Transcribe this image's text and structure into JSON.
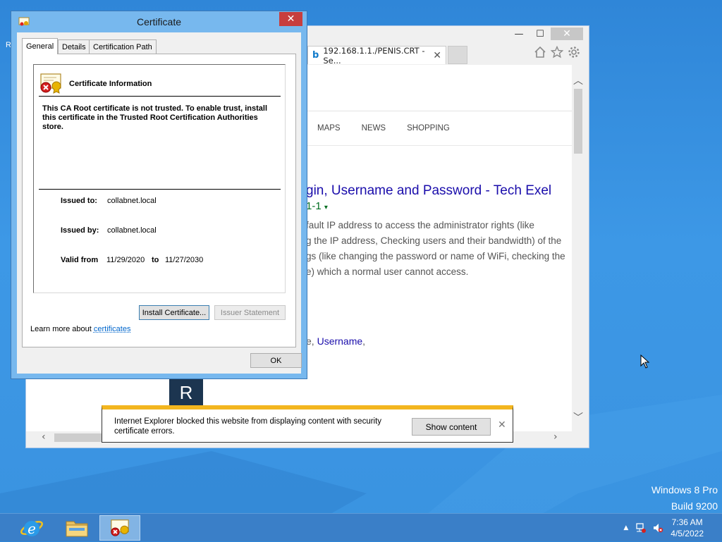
{
  "ie": {
    "tab_title": "192.168.1.1./PENIS.CRT - Se...",
    "tab_close": "✕",
    "caption": {
      "minimize": "—",
      "maximize": "☐",
      "close": "✕"
    },
    "nav": [
      "MAPS",
      "NEWS",
      "SHOPPING"
    ],
    "result_title": "gin, Username and Password - Tech Exel",
    "result_url": "1-1",
    "result_lines": [
      "fault IP address to access the administrator rights (like",
      "g the IP address, Checking users and their bandwidth) of the",
      "gs (like changing the password or name of WiFi, checking the",
      "e) which a normal user cannot access."
    ],
    "result_link2_prefix": "e, ",
    "result_link2": "Username",
    "result_link2_suffix": ","
  },
  "logo_letter": "R",
  "desktop_letter": "R",
  "notification": {
    "message": "Internet Explorer blocked this website from displaying content with security certificate errors.",
    "button": "Show content",
    "close": "✕"
  },
  "cert": {
    "title": "Certificate",
    "close": "✕",
    "tabs": [
      "General",
      "Details",
      "Certification Path"
    ],
    "heading": "Certificate Information",
    "warning": "This CA Root certificate is not trusted. To enable trust, install this certificate in the Trusted Root Certification Authorities store.",
    "issued_to_label": "Issued to:",
    "issued_to": "collabnet.local",
    "issued_by_label": "Issued by:",
    "issued_by": "collabnet.local",
    "valid_from_label": "Valid from",
    "valid_from": "11/29/2020",
    "to_label": "to",
    "valid_to": "11/27/2030",
    "install_button": "Install Certificate...",
    "issuer_button": "Issuer Statement",
    "learn_more_prefix": "Learn more about ",
    "learn_more_link": "certificates",
    "ok_button": "OK"
  },
  "desktop": {
    "edition": "Windows 8 Pro",
    "build": "Build 9200"
  },
  "taskbar": {
    "time": "7:36 AM",
    "date": "4/5/2022",
    "icons": [
      "internet-explorer-icon",
      "file-explorer-icon",
      "certificate-icon"
    ]
  },
  "colors": {
    "desktop": "#3a93e0",
    "taskbar": "#3a7fc8",
    "dialog_frame": "#77b8ee",
    "close_red": "#c73e3e",
    "link": "#1a0dab",
    "url_green": "#006d21",
    "notification_bar": "#f3b61f"
  }
}
